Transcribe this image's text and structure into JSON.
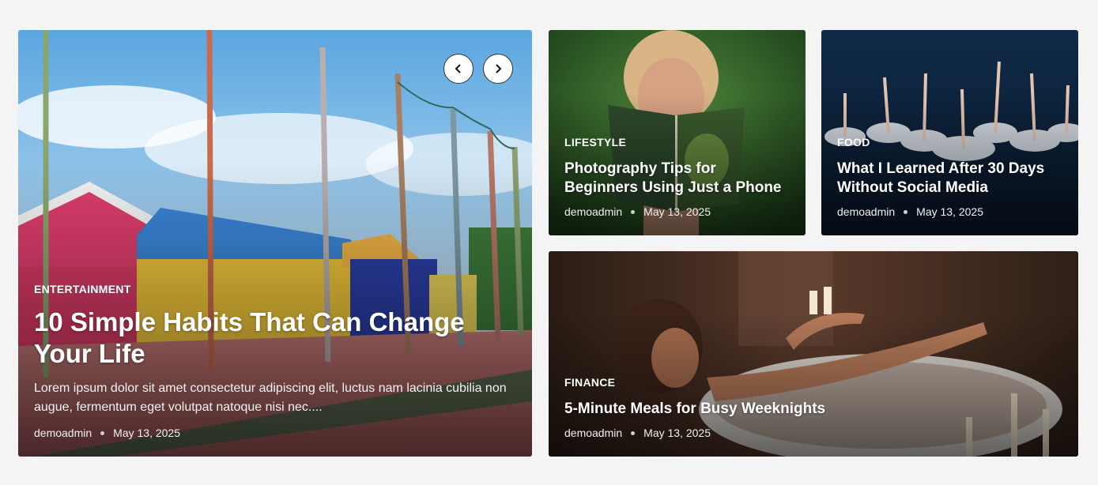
{
  "slider": {
    "prev_icon": "chevron-left-icon",
    "next_icon": "chevron-right-icon"
  },
  "featured": {
    "category": "ENTERTAINMENT",
    "title": "10 Simple Habits That Can Change Your Life",
    "excerpt": "Lorem ipsum dolor sit amet consectetur adipiscing elit, luctus nam lacinia cubilia non augue, fermentum eget volutpat natoque nisi nec....",
    "author": "demoadmin",
    "date": "May 13, 2025"
  },
  "posts": [
    {
      "category": "LIFESTYLE",
      "title": "Photography Tips for Beginners Using Just a Phone",
      "author": "demoadmin",
      "date": "May 13, 2025"
    },
    {
      "category": "FOOD",
      "title": "What I Learned After 30 Days Without Social Media",
      "author": "demoadmin",
      "date": "May 13, 2025"
    },
    {
      "category": "FINANCE",
      "title": "5-Minute Meals for Busy Weeknights",
      "author": "demoadmin",
      "date": "May 13, 2025"
    }
  ],
  "colors": {
    "page_bg": "#f4f4f4",
    "text": "#ffffff"
  }
}
